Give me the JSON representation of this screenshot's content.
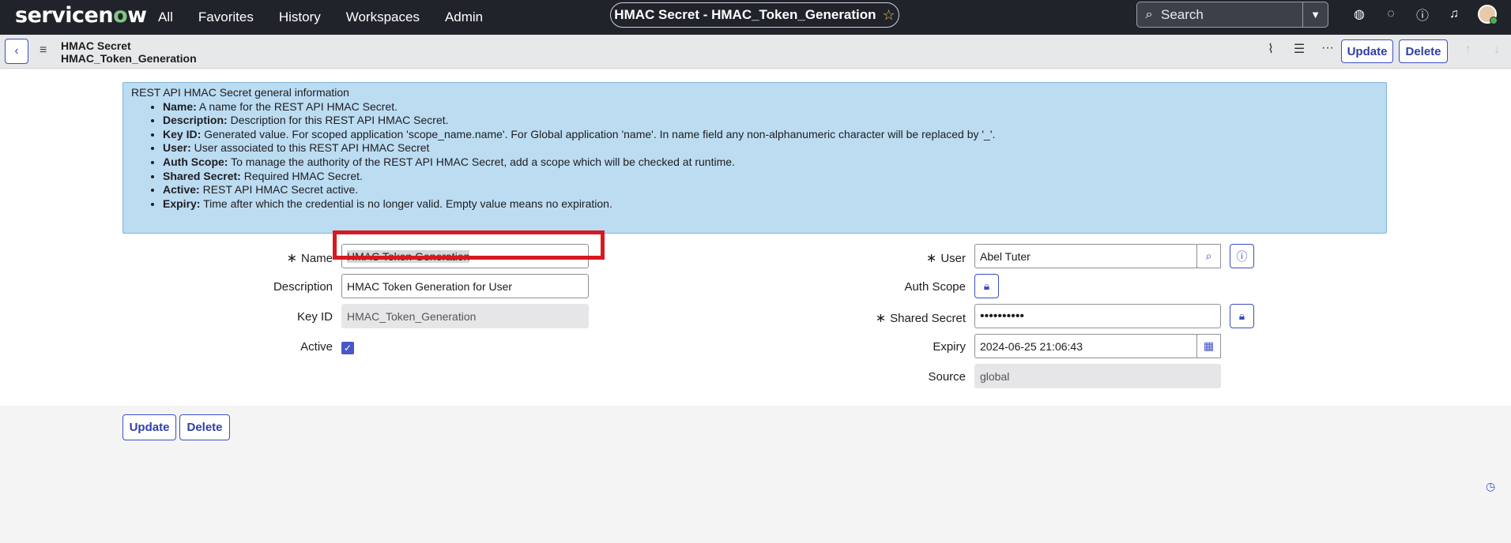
{
  "brand": {
    "name_pre": "servicen",
    "name_o": "o",
    "name_post": "w"
  },
  "nav": {
    "items": [
      "All",
      "Favorites",
      "History",
      "Workspaces",
      "Admin"
    ]
  },
  "record_title": "HMAC Secret - HMAC_Token_Generation",
  "search": {
    "placeholder": "Search"
  },
  "header": {
    "line1": "HMAC Secret",
    "line2": "HMAC_Token_Generation",
    "update": "Update",
    "delete": "Delete"
  },
  "info": {
    "heading": "REST API HMAC Secret general information",
    "items": [
      {
        "term": "Name:",
        "desc": " A name for the REST API HMAC Secret."
      },
      {
        "term": "Description:",
        "desc": " Description for this REST API HMAC Secret."
      },
      {
        "term": "Key ID:",
        "desc": " Generated value. For scoped application 'scope_name.name'. For Global application 'name'. In name field any non-alphanumeric character will be replaced by '_'."
      },
      {
        "term": "User:",
        "desc": " User associated to this REST API HMAC Secret"
      },
      {
        "term": "Auth Scope:",
        "desc": " To manage the authority of the REST API HMAC Secret, add a scope which will be checked at runtime."
      },
      {
        "term": "Shared Secret:",
        "desc": " Required HMAC Secret."
      },
      {
        "term": "Active:",
        "desc": " REST API HMAC Secret active."
      },
      {
        "term": "Expiry:",
        "desc": " Time after which the credential is no longer valid. Empty value means no expiration."
      }
    ]
  },
  "form": {
    "required_mark": "∗",
    "name_label": "Name",
    "name_value": "HMAC Token Generation",
    "description_label": "Description",
    "description_value": "HMAC Token Generation for User",
    "keyid_label": "Key ID",
    "keyid_value": "HMAC_Token_Generation",
    "active_label": "Active",
    "active_checked": true,
    "user_label": "User",
    "user_value": "Abel Tuter",
    "authscope_label": "Auth Scope",
    "secret_label": "Shared Secret",
    "secret_value": "••••••••••",
    "expiry_label": "Expiry",
    "expiry_value": "2024-06-25 21:06:43",
    "source_label": "Source",
    "source_value": "global"
  },
  "footer": {
    "update": "Update",
    "delete": "Delete"
  },
  "colors": {
    "accent": "#3b4fc4",
    "nav_bg": "#20232a",
    "info_bg": "#bcdcf2",
    "highlight": "#d71920"
  }
}
